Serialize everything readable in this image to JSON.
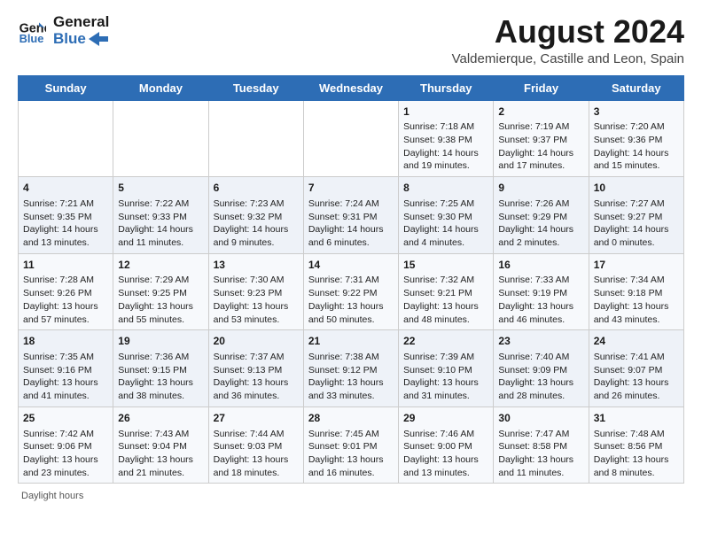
{
  "header": {
    "logo_line1": "General",
    "logo_line2": "Blue",
    "main_title": "August 2024",
    "sub_title": "Valdemierque, Castille and Leon, Spain"
  },
  "weekdays": [
    "Sunday",
    "Monday",
    "Tuesday",
    "Wednesday",
    "Thursday",
    "Friday",
    "Saturday"
  ],
  "weeks": [
    [
      {
        "num": "",
        "info": ""
      },
      {
        "num": "",
        "info": ""
      },
      {
        "num": "",
        "info": ""
      },
      {
        "num": "",
        "info": ""
      },
      {
        "num": "1",
        "info": "Sunrise: 7:18 AM\nSunset: 9:38 PM\nDaylight: 14 hours and 19 minutes."
      },
      {
        "num": "2",
        "info": "Sunrise: 7:19 AM\nSunset: 9:37 PM\nDaylight: 14 hours and 17 minutes."
      },
      {
        "num": "3",
        "info": "Sunrise: 7:20 AM\nSunset: 9:36 PM\nDaylight: 14 hours and 15 minutes."
      }
    ],
    [
      {
        "num": "4",
        "info": "Sunrise: 7:21 AM\nSunset: 9:35 PM\nDaylight: 14 hours and 13 minutes."
      },
      {
        "num": "5",
        "info": "Sunrise: 7:22 AM\nSunset: 9:33 PM\nDaylight: 14 hours and 11 minutes."
      },
      {
        "num": "6",
        "info": "Sunrise: 7:23 AM\nSunset: 9:32 PM\nDaylight: 14 hours and 9 minutes."
      },
      {
        "num": "7",
        "info": "Sunrise: 7:24 AM\nSunset: 9:31 PM\nDaylight: 14 hours and 6 minutes."
      },
      {
        "num": "8",
        "info": "Sunrise: 7:25 AM\nSunset: 9:30 PM\nDaylight: 14 hours and 4 minutes."
      },
      {
        "num": "9",
        "info": "Sunrise: 7:26 AM\nSunset: 9:29 PM\nDaylight: 14 hours and 2 minutes."
      },
      {
        "num": "10",
        "info": "Sunrise: 7:27 AM\nSunset: 9:27 PM\nDaylight: 14 hours and 0 minutes."
      }
    ],
    [
      {
        "num": "11",
        "info": "Sunrise: 7:28 AM\nSunset: 9:26 PM\nDaylight: 13 hours and 57 minutes."
      },
      {
        "num": "12",
        "info": "Sunrise: 7:29 AM\nSunset: 9:25 PM\nDaylight: 13 hours and 55 minutes."
      },
      {
        "num": "13",
        "info": "Sunrise: 7:30 AM\nSunset: 9:23 PM\nDaylight: 13 hours and 53 minutes."
      },
      {
        "num": "14",
        "info": "Sunrise: 7:31 AM\nSunset: 9:22 PM\nDaylight: 13 hours and 50 minutes."
      },
      {
        "num": "15",
        "info": "Sunrise: 7:32 AM\nSunset: 9:21 PM\nDaylight: 13 hours and 48 minutes."
      },
      {
        "num": "16",
        "info": "Sunrise: 7:33 AM\nSunset: 9:19 PM\nDaylight: 13 hours and 46 minutes."
      },
      {
        "num": "17",
        "info": "Sunrise: 7:34 AM\nSunset: 9:18 PM\nDaylight: 13 hours and 43 minutes."
      }
    ],
    [
      {
        "num": "18",
        "info": "Sunrise: 7:35 AM\nSunset: 9:16 PM\nDaylight: 13 hours and 41 minutes."
      },
      {
        "num": "19",
        "info": "Sunrise: 7:36 AM\nSunset: 9:15 PM\nDaylight: 13 hours and 38 minutes."
      },
      {
        "num": "20",
        "info": "Sunrise: 7:37 AM\nSunset: 9:13 PM\nDaylight: 13 hours and 36 minutes."
      },
      {
        "num": "21",
        "info": "Sunrise: 7:38 AM\nSunset: 9:12 PM\nDaylight: 13 hours and 33 minutes."
      },
      {
        "num": "22",
        "info": "Sunrise: 7:39 AM\nSunset: 9:10 PM\nDaylight: 13 hours and 31 minutes."
      },
      {
        "num": "23",
        "info": "Sunrise: 7:40 AM\nSunset: 9:09 PM\nDaylight: 13 hours and 28 minutes."
      },
      {
        "num": "24",
        "info": "Sunrise: 7:41 AM\nSunset: 9:07 PM\nDaylight: 13 hours and 26 minutes."
      }
    ],
    [
      {
        "num": "25",
        "info": "Sunrise: 7:42 AM\nSunset: 9:06 PM\nDaylight: 13 hours and 23 minutes."
      },
      {
        "num": "26",
        "info": "Sunrise: 7:43 AM\nSunset: 9:04 PM\nDaylight: 13 hours and 21 minutes."
      },
      {
        "num": "27",
        "info": "Sunrise: 7:44 AM\nSunset: 9:03 PM\nDaylight: 13 hours and 18 minutes."
      },
      {
        "num": "28",
        "info": "Sunrise: 7:45 AM\nSunset: 9:01 PM\nDaylight: 13 hours and 16 minutes."
      },
      {
        "num": "29",
        "info": "Sunrise: 7:46 AM\nSunset: 9:00 PM\nDaylight: 13 hours and 13 minutes."
      },
      {
        "num": "30",
        "info": "Sunrise: 7:47 AM\nSunset: 8:58 PM\nDaylight: 13 hours and 11 minutes."
      },
      {
        "num": "31",
        "info": "Sunrise: 7:48 AM\nSunset: 8:56 PM\nDaylight: 13 hours and 8 minutes."
      }
    ]
  ],
  "footer": "Daylight hours"
}
